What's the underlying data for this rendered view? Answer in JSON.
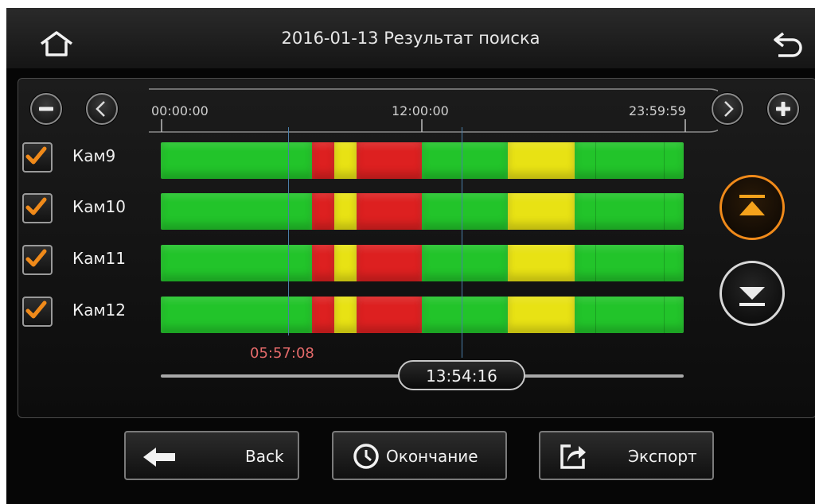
{
  "header": {
    "title": "2016-01-13  Результат поиска",
    "home_icon": "home-icon",
    "return_icon": "return-arrow-icon"
  },
  "timeline": {
    "zoom_out_icon": "minus-icon",
    "prev_icon": "chevron-left-icon",
    "next_icon": "chevron-right-icon",
    "zoom_in_icon": "plus-icon",
    "ticks": [
      "00:00:00",
      "12:00:00",
      "23:59:59"
    ],
    "marker_time": "05:57:08",
    "cursor_time": "13:54:16"
  },
  "cameras": [
    {
      "label": "Кам9",
      "checked": true
    },
    {
      "label": "Кам10",
      "checked": true
    },
    {
      "label": "Кам11",
      "checked": true
    },
    {
      "label": "Кам12",
      "checked": true
    }
  ],
  "colors": {
    "normal": "#22c42a",
    "motion": "#e8e214",
    "alarm": "#dd2020",
    "accent": "#f08a1a"
  },
  "scroll": {
    "up_icon": "scroll-top-icon",
    "down_icon": "scroll-bottom-icon"
  },
  "buttons": {
    "back_label": "Back",
    "end_label": "Окончание",
    "export_label": "Экспорт"
  }
}
